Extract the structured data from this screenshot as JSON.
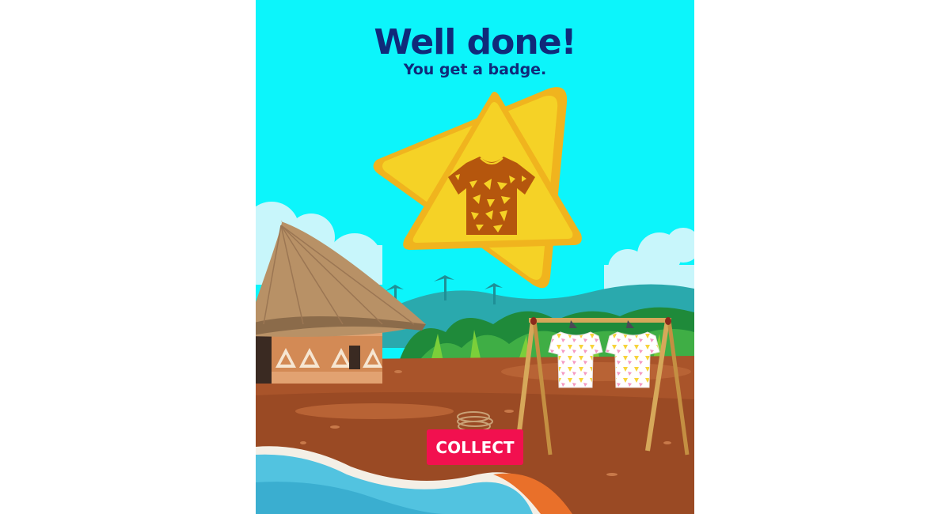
{
  "dialog": {
    "title": "Well done!",
    "subtitle": "You get a badge.",
    "collect_label": "COLLECT"
  },
  "badge": {
    "icon": "t-shirt-icon",
    "color": "#f5d226"
  },
  "colors": {
    "sky": "#0cf5fb",
    "title": "#102a7a",
    "button": "#f2104f",
    "ground": "#a9542a",
    "water": "#52c3e0"
  }
}
